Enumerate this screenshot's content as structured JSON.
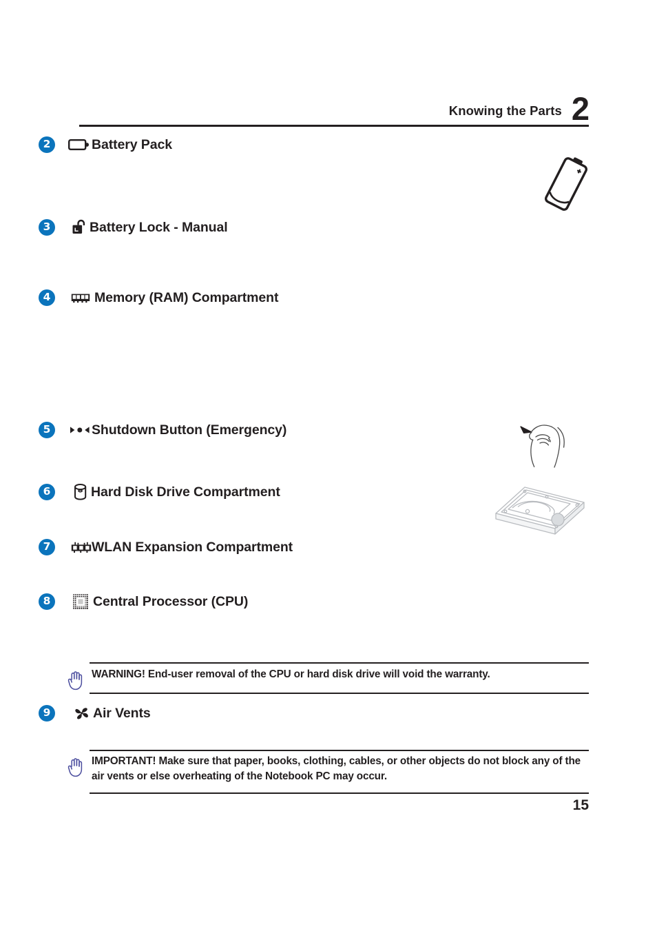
{
  "header": {
    "title": "Knowing the Parts",
    "chapter": "2"
  },
  "parts": [
    {
      "number": "2",
      "icon": "battery-icon",
      "label": "Battery Pack"
    },
    {
      "number": "3",
      "icon": "padlock-open-icon",
      "label": "Battery Lock - Manual"
    },
    {
      "number": "4",
      "icon": "ram-module-icon",
      "label": "Memory (RAM) Compartment"
    },
    {
      "number": "5",
      "icon": "shutdown-pin-icon",
      "label": "Shutdown Button (Emergency)"
    },
    {
      "number": "6",
      "icon": "hard-disk-icon",
      "label": "Hard Disk Drive Compartment"
    },
    {
      "number": "7",
      "icon": "wlan-card-icon",
      "label": "WLAN Expansion Compartment"
    },
    {
      "number": "8",
      "icon": "cpu-chip-icon",
      "label": "Central Processor (CPU)"
    },
    {
      "number": "9",
      "icon": "fan-icon",
      "label": "Air Vents"
    }
  ],
  "notices": [
    {
      "id": "warning",
      "icon": "stop-hand-icon",
      "text": "WARNING!  End-user removal of the CPU or hard disk drive will void the warranty."
    },
    {
      "id": "important",
      "icon": "stop-hand-icon",
      "text": "IMPORTANT!  Make sure that paper, books, clothing, cables, or other objects do not block any of the air vents or else overheating of the Notebook PC may occur."
    }
  ],
  "illustrations": [
    {
      "id": "battery-cell-illustration"
    },
    {
      "id": "hand-pressing-pin-illustration"
    },
    {
      "id": "hard-disk-drive-illustration"
    }
  ],
  "footer": {
    "page_number": "15"
  },
  "colors": {
    "bullet_blue": "#0b74bc",
    "text_black": "#231f20",
    "hand_icon_purple": "#4b4d9e"
  }
}
